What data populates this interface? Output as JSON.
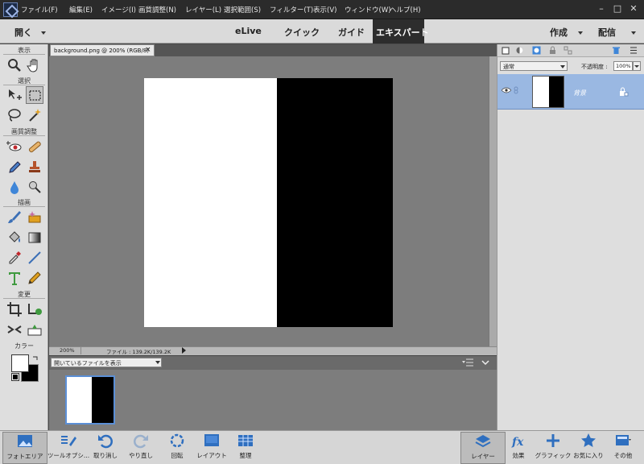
{
  "menu": [
    "ファイル(F)",
    "編集(E)",
    "イメージ(I)",
    "画質調整(N)",
    "レイヤー(L)",
    "選択範囲(S)",
    "フィルター(T)",
    "表示(V)",
    "ウィンドウ(W)",
    "ヘルプ(H)"
  ],
  "window_controls": {
    "minimize": "–",
    "maximize": "□",
    "close": "✕"
  },
  "modebar": {
    "open_label": "開く",
    "tabs": [
      "eLive",
      "クイック",
      "ガイド",
      "エキスパート"
    ],
    "active_tab": "エキスパート",
    "create_label": "作成",
    "share_label": "配信"
  },
  "toolbox": {
    "sections": [
      "表示",
      "選択",
      "画質調整",
      "描画",
      "変更",
      "カラー"
    ]
  },
  "document": {
    "tab_title": "background.png @ 200% (RGB/8)",
    "zoom": "200%",
    "file_info": "ファイル : 139.2K/139.2K"
  },
  "photo_bin": {
    "filter_select": "開いているファイルを表示"
  },
  "layers_panel": {
    "blend_mode": "通常",
    "opacity_label": "不透明度 :",
    "opacity_value": "100%",
    "layer_name": "背景"
  },
  "bottom_bar": {
    "photo_bin": "フォトエリア",
    "tool_options": "ツールオプシ...",
    "undo": "取り消し",
    "redo": "やり直し",
    "rotate": "回転",
    "layout": "レイアウト",
    "organize": "整理",
    "layers": "レイヤー",
    "effects": "効果",
    "graphics": "グラフィック",
    "favorites": "お気に入り",
    "more": "その他"
  },
  "colors": {
    "accent": "#5b8fd6",
    "layer_selected": "#9ab8e2",
    "canvas_bg": "#7d7d7d"
  }
}
